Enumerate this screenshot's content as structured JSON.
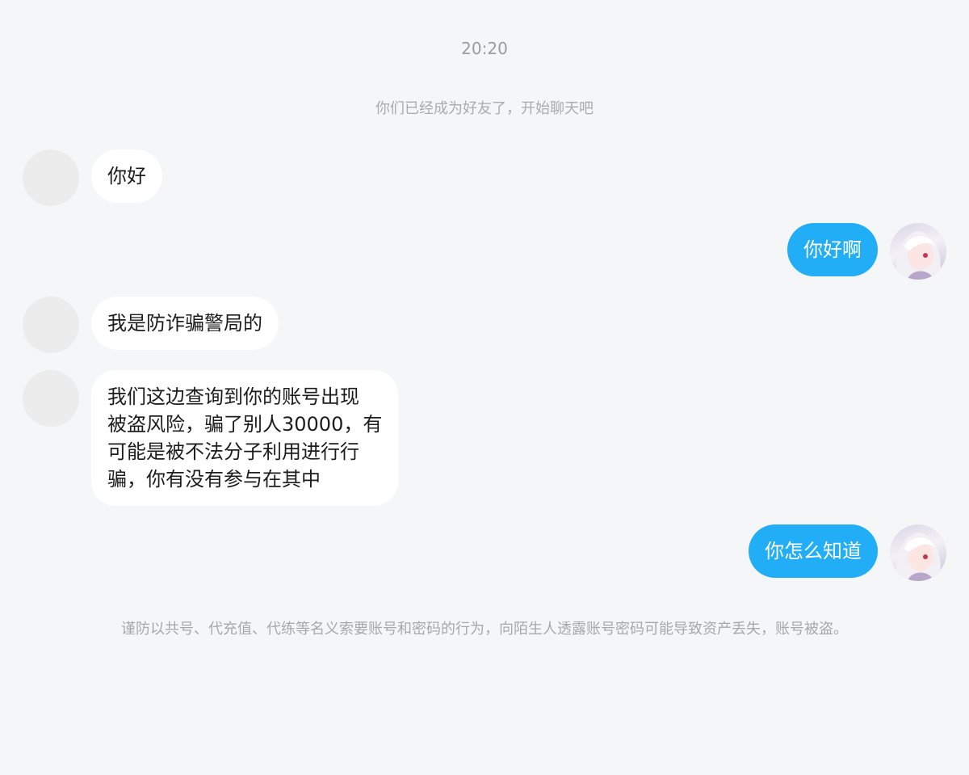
{
  "chat": {
    "time": "20:20",
    "system_notice": "你们已经成为好友了，开始聊天吧",
    "messages": [
      {
        "side": "left",
        "text": "你好"
      },
      {
        "side": "right",
        "text": "你好啊"
      },
      {
        "side": "left",
        "text": "我是防诈骗警局的"
      },
      {
        "side": "left",
        "text": "我们这边查询到你的账号出现\n被盗风险，骗了别人30000，有\n可能是被不法分子利用进行行\n骗，你有没有参与在其中"
      },
      {
        "side": "right",
        "text": "你怎么知道"
      }
    ],
    "warning": "谨防以共号、代充值、代练等名义索要账号和密码的行为，向陌生人透露账号密码可能导致资产丢失，账号被盗。"
  },
  "colors": {
    "background": "#f5f6f8",
    "incoming_bubble": "#ffffff",
    "outgoing_bubble": "#21aef7",
    "muted_text": "#9c9c9c"
  },
  "icons": {
    "contact_avatar": "blank-avatar",
    "self_avatar": "anime-girl-avatar"
  }
}
